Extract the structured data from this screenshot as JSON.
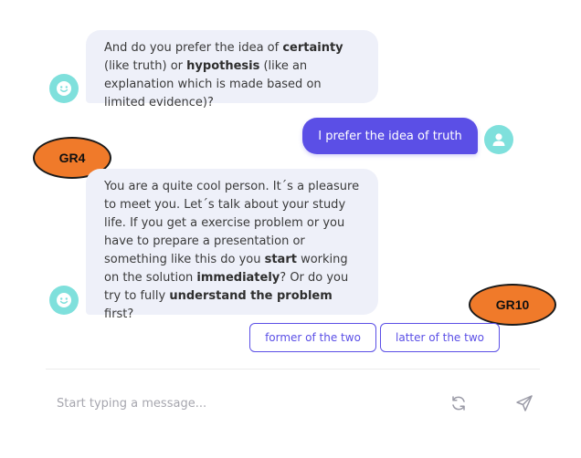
{
  "colors": {
    "accent": "#5b4fe6",
    "bot_bubble": "#eef0f9",
    "avatar": "#7fe0dc",
    "annotation": "#f07a2a"
  },
  "messages": [
    {
      "sender": "bot",
      "segments": [
        {
          "text": "And do you prefer the idea of ",
          "bold": false
        },
        {
          "text": "certainty",
          "bold": true
        },
        {
          "text": " (like truth) or ",
          "bold": false
        },
        {
          "text": "hypothesis",
          "bold": true
        },
        {
          "text": " (like an explanation which is made based on limited evidence)?",
          "bold": false
        }
      ]
    },
    {
      "sender": "user",
      "text": "I prefer the idea of truth"
    },
    {
      "sender": "bot",
      "segments": [
        {
          "text": "You are a quite cool person. It´s a pleasure to meet you. Let´s talk about your study life. If you get a exercise problem or you have to prepare a presentation or something like this do you ",
          "bold": false
        },
        {
          "text": "start",
          "bold": true
        },
        {
          "text": " working on the solution ",
          "bold": false
        },
        {
          "text": "immediately",
          "bold": true
        },
        {
          "text": "? Or do you try to fully ",
          "bold": false
        },
        {
          "text": "understand the problem",
          "bold": true
        },
        {
          "text": " first?",
          "bold": false
        }
      ]
    }
  ],
  "annotations": {
    "gr4": "GR4",
    "gr10": "GR10"
  },
  "quick_replies": [
    "former of the two",
    "latter of the two"
  ],
  "composer": {
    "placeholder": "Start typing a message..."
  },
  "icons": {
    "bot_avatar": "smiley-face-icon",
    "user_avatar": "user-icon",
    "refresh": "refresh-icon",
    "send": "send-icon"
  }
}
